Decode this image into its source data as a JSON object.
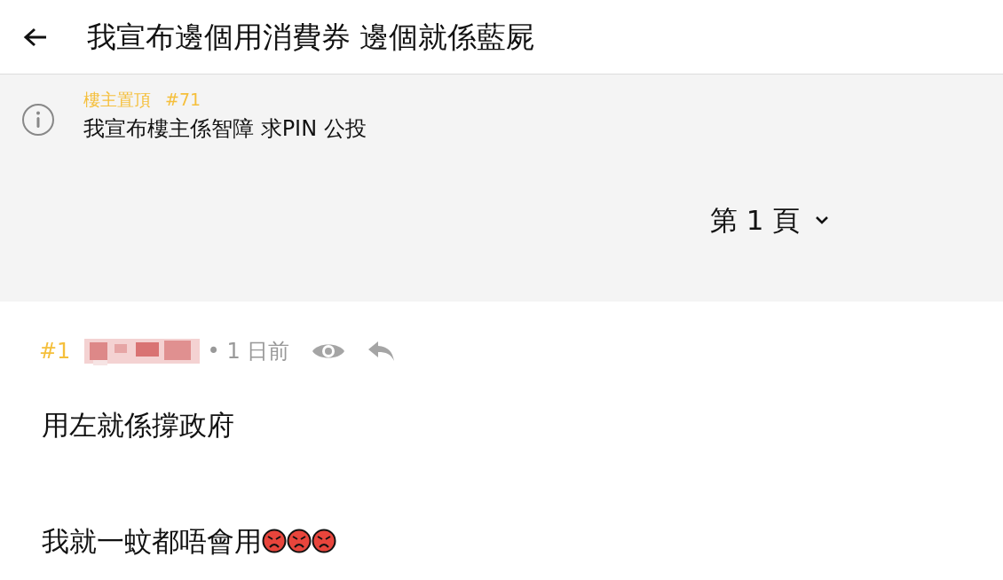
{
  "header": {
    "title": "我宣布邊個用消費券 邊個就係藍屍"
  },
  "pinned": {
    "label": "樓主置頂",
    "post_number": "#71",
    "text": "我宣布樓主係智障 求PIN 公投"
  },
  "page_selector": {
    "label": "第 1 頁"
  },
  "post": {
    "number": "#1",
    "separator": "•",
    "time": "1 日前",
    "content": [
      {
        "text": "用左就係撐政府"
      },
      {
        "text": "我就一蚊都唔會用",
        "emojis": [
          {
            "kind": "angry"
          },
          {
            "kind": "angry"
          },
          {
            "kind": "angry"
          }
        ]
      }
    ]
  }
}
